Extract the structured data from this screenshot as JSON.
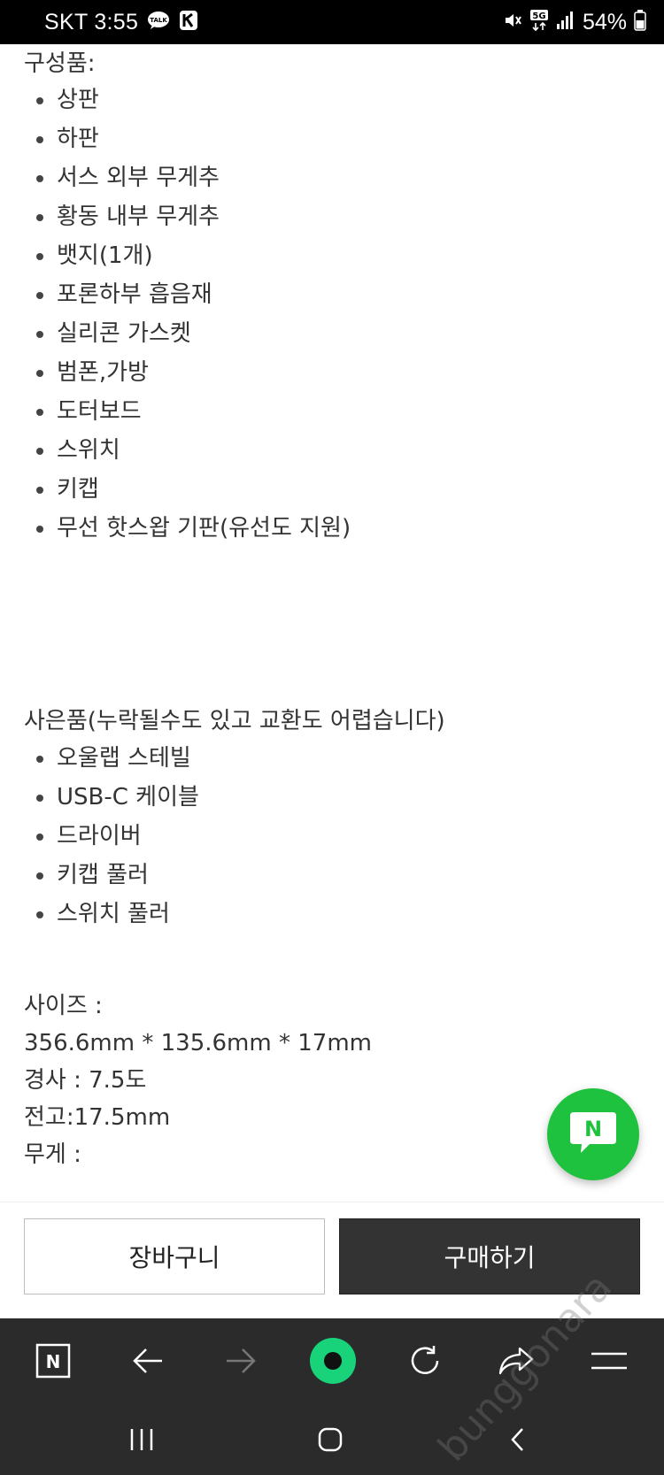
{
  "status_bar": {
    "carrier_time": "SKT 3:55",
    "talk_badge": "TALK",
    "network": "5G",
    "battery": "54%"
  },
  "content": {
    "components_heading": "구성품:",
    "components": [
      "상판",
      "하판",
      "서스 외부 무게추",
      "황동 내부 무게추",
      "뱃지(1개)",
      "포론하부 흡음재",
      "실리콘 가스켓",
      "범폰,가방",
      "도터보드",
      "스위치",
      "키캡",
      "무선 핫스왑 기판(유선도 지원)"
    ],
    "gifts_heading": "사은품(누락될수도 있고 교환도 어렵습니다)",
    "gifts": [
      "오울랩 스테빌",
      "USB-C 케이블",
      "드라이버",
      "키캡 풀러",
      "스위치 풀러"
    ],
    "size_label": "사이즈 :",
    "size_value": "356.6mm * 135.6mm * 17mm",
    "angle": "경사 : 7.5도",
    "front_height": "전고:17.5mm",
    "weight_label": "무게 :"
  },
  "naver_talk": {
    "icon": "naver-talk-icon",
    "letter": "N",
    "color": "#1fc23f"
  },
  "buy_bar": {
    "cart_label": "장바구니",
    "buy_label": "구매하기"
  },
  "browser_toolbar": {
    "home_letter": "N",
    "icons": [
      "naver-home-icon",
      "back-icon",
      "forward-icon",
      "green-dot-icon",
      "refresh-icon",
      "share-icon",
      "menu-icon"
    ]
  },
  "system_nav": {
    "icons": [
      "recent-apps-icon",
      "home-icon",
      "back-nav-icon"
    ]
  },
  "watermark": "bunggonara"
}
